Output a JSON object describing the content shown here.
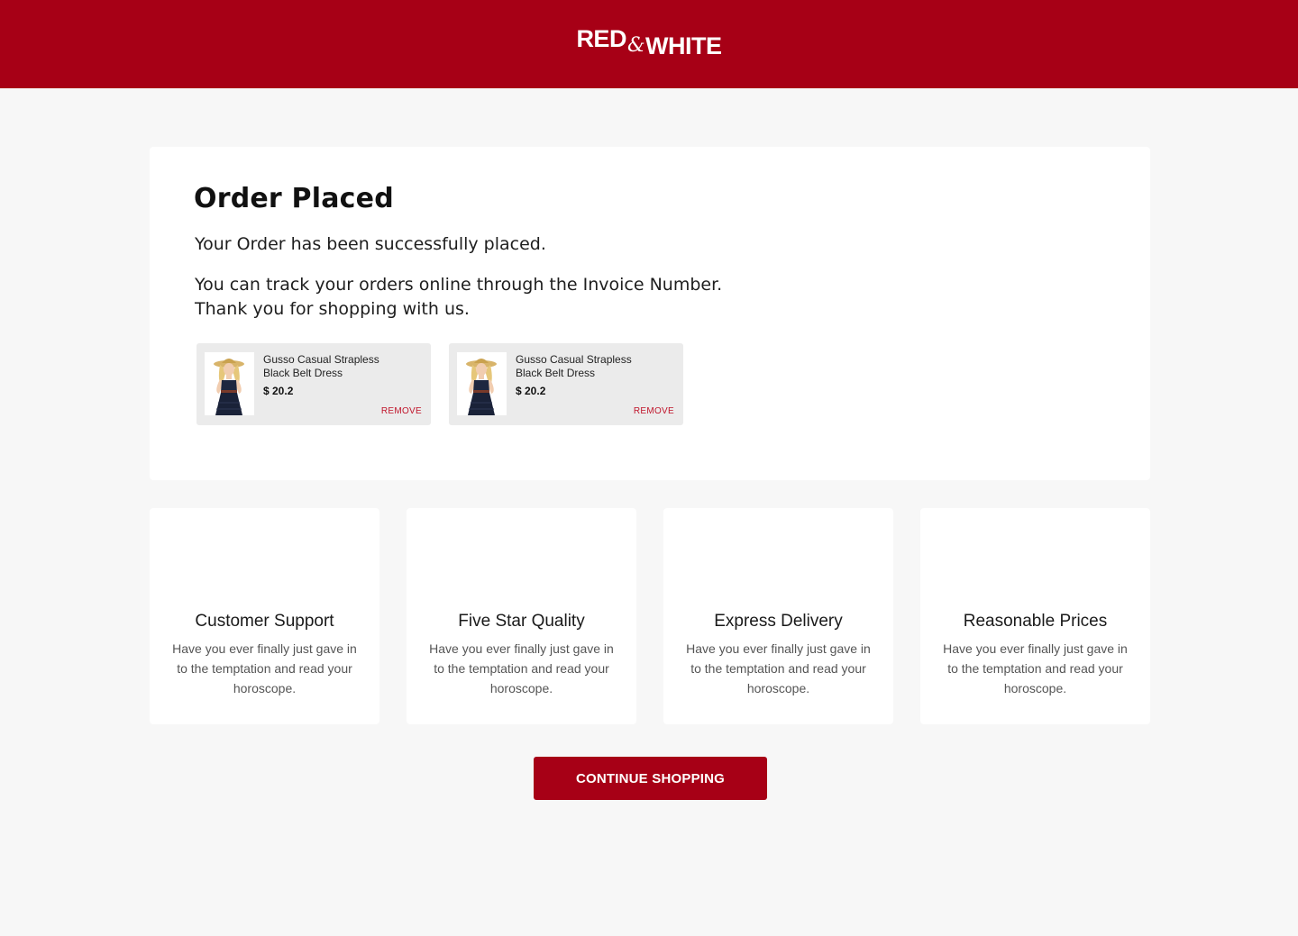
{
  "brand": {
    "part1": "RED",
    "amp": "&",
    "part2": "WHITE"
  },
  "order": {
    "title": "Order Placed",
    "message": "Your Order has been successfully placed.",
    "track_line1": "You can track your orders online through the Invoice Number.",
    "track_line2": "Thank you for shopping with us."
  },
  "items": [
    {
      "name": "Gusso Casual Strapless Black Belt Dress",
      "price": "$ 20.2",
      "remove_label": "REMOVE",
      "image_icon": "dress-product-image"
    },
    {
      "name": "Gusso Casual Strapless Black Belt Dress",
      "price": "$ 20.2",
      "remove_label": "REMOVE",
      "image_icon": "dress-product-image"
    }
  ],
  "features": [
    {
      "title": "Customer Support",
      "description": "Have you ever finally just gave in to the temptation and read your horoscope."
    },
    {
      "title": "Five Star Quality",
      "description": "Have you ever finally just gave in to the temptation and read your horoscope."
    },
    {
      "title": "Express Delivery",
      "description": "Have you ever finally just gave in to the temptation and read your horoscope."
    },
    {
      "title": "Reasonable Prices",
      "description": "Have you ever finally just gave in to the temptation and read your horoscope."
    }
  ],
  "cta": {
    "label": "CONTINUE SHOPPING"
  },
  "colors": {
    "brand": "#a70016",
    "remove": "#c0152b",
    "background": "#f7f7f7",
    "item_bg": "#ebebeb"
  }
}
